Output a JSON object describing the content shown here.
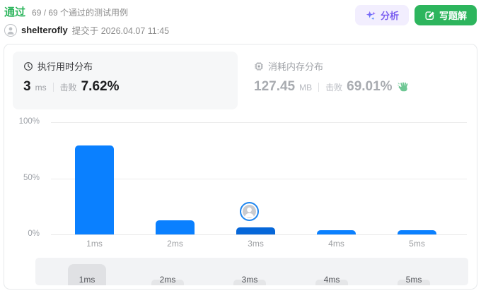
{
  "status": {
    "label": "通过",
    "summary": "69 / 69 个通过的测试用例"
  },
  "submission": {
    "user": "shelterofly",
    "meta": "提交于 2026.04.07 11:45"
  },
  "actions": {
    "analyze": "分析",
    "write_solution": "写题解"
  },
  "stats": {
    "runtime": {
      "title": "执行用时分布",
      "value": "3",
      "unit": "ms",
      "beat_label": "击败",
      "beat": "7.62%"
    },
    "memory": {
      "title": "消耗内存分布",
      "value": "127.45",
      "unit": "MB",
      "beat_label": "击败",
      "beat": "69.01%"
    }
  },
  "chart_data": {
    "type": "bar",
    "title": "执行用时分布",
    "categories": [
      "1ms",
      "2ms",
      "3ms",
      "4ms",
      "5ms"
    ],
    "values": [
      79,
      12.7,
      6.5,
      3.8,
      3.8
    ],
    "selected_index": 2,
    "xlabel": "",
    "ylabel": "",
    "ylim": [
      0,
      100
    ],
    "ytick_values": [
      100,
      50,
      0
    ],
    "ytick_labels": [
      "100%",
      "50%",
      "0%"
    ],
    "grid": true,
    "legend": "none"
  },
  "minimap": {
    "labels": [
      "1ms",
      "2ms",
      "3ms",
      "4ms",
      "5ms"
    ],
    "selected_index": 0
  },
  "colors": {
    "bar_blue": "#0a80ff",
    "bar_selected": "#0667d9",
    "success_green": "#2db55d",
    "analyze_purple": "#7c5ff0",
    "clap_green": "#6ec794"
  }
}
